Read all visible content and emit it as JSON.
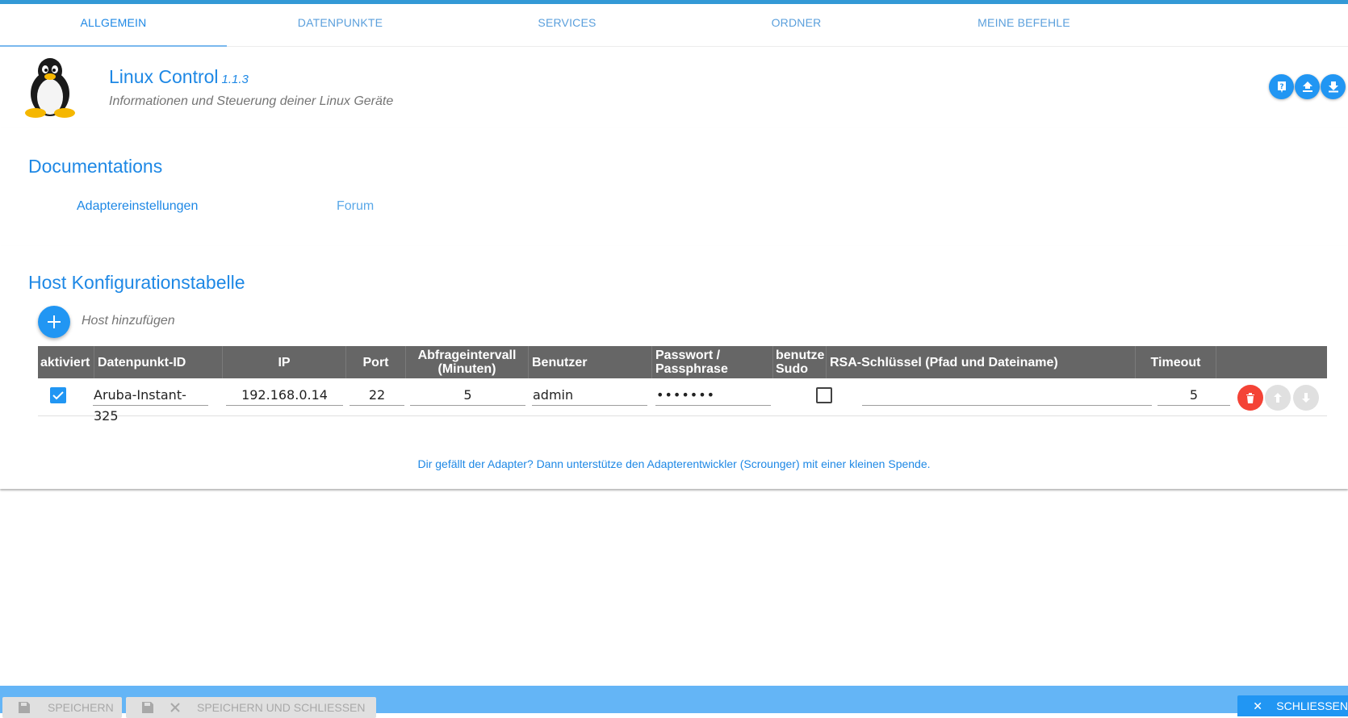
{
  "tabs": [
    "ALLGEMEIN",
    "DATENPUNKTE",
    "SERVICES",
    "ORDNER",
    "MEINE BEFEHLE"
  ],
  "active_tab": "ALLGEMEIN",
  "header": {
    "title": "Linux Control",
    "version": "1.1.3",
    "subtitle": "Informationen und Steuerung deiner Linux Geräte",
    "logo_icon": "tux-penguin-icon",
    "buttons": [
      "help-icon",
      "upload-icon",
      "download-icon"
    ]
  },
  "documentation": {
    "heading": "Documentations",
    "links": [
      "Adaptereinstellungen",
      "Forum"
    ]
  },
  "hosts": {
    "heading": "Host Konfigurationstabelle",
    "add_label": "Host hinzufügen",
    "columns": {
      "enabled": "aktiviert",
      "id": "Datenpunkt-ID",
      "ip": "IP",
      "port": "Port",
      "interval_1": "Abfrageintervall",
      "interval_2": "(Minuten)",
      "user": "Benutzer",
      "password_1": "Passwort /",
      "password_2": "Passphrase",
      "sudo_1": "benutze",
      "sudo_2": "Sudo",
      "rsa": "RSA-Schlüssel (Pfad und Dateiname)",
      "timeout": "Timeout"
    },
    "rows": [
      {
        "enabled": true,
        "id": "Aruba-Instant-325",
        "ip": "192.168.0.14",
        "port": "22",
        "interval": "5",
        "user": "admin",
        "password": "•••••••",
        "sudo": false,
        "rsa": "",
        "timeout": "5"
      }
    ]
  },
  "footer": {
    "donate": "Dir gefällt der Adapter? Dann unterstütze den Adapterentwickler (Scrounger) mit einer kleinen Spende."
  },
  "bottom": {
    "save": "SPEICHERN",
    "save_close": "SPEICHERN UND SCHLIESSEN",
    "close": "SCHLIESSEN"
  },
  "colors": {
    "accent": "#1e88e5",
    "fab": "#2196f3",
    "bottombar": "#64b5f6",
    "delete": "#f44336",
    "table_header": "#666666"
  }
}
